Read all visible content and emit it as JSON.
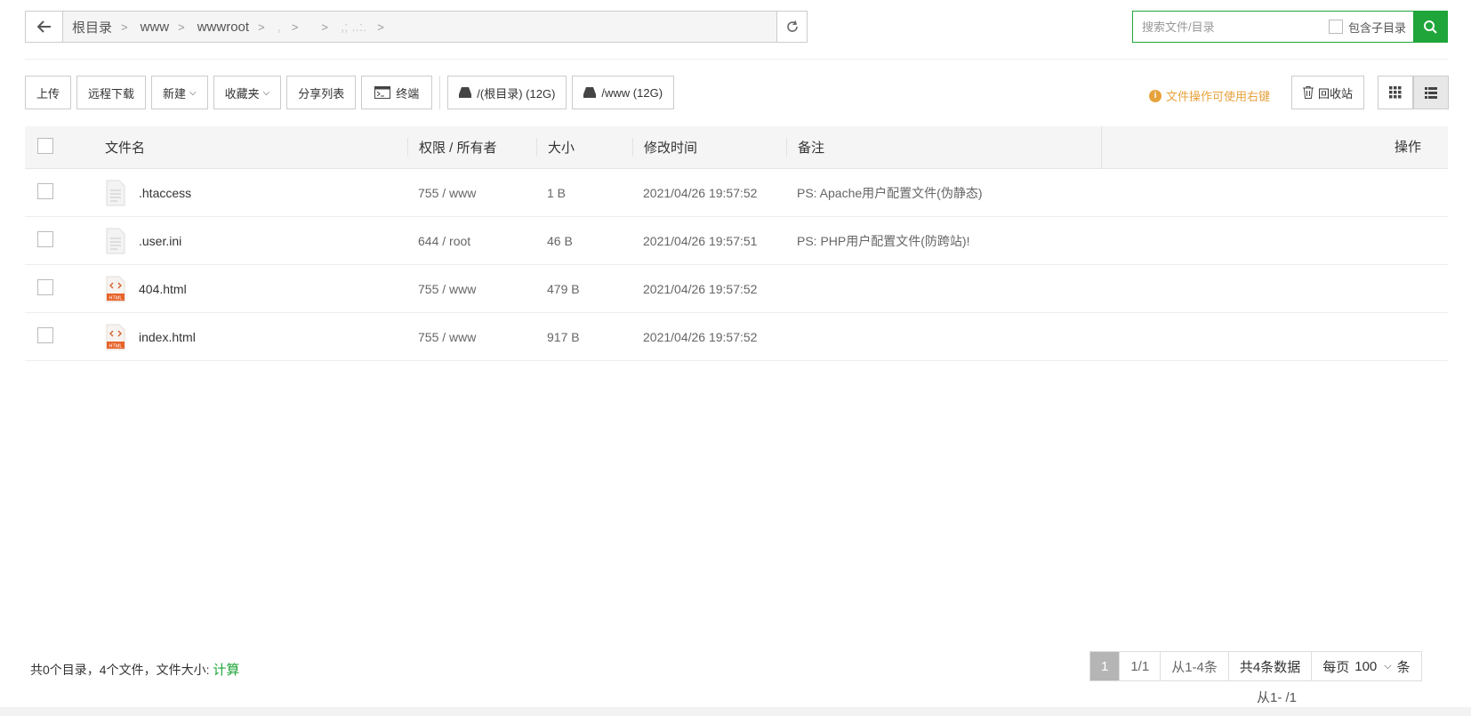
{
  "path": {
    "crumbs": [
      "根目录",
      "www",
      "wwwroot"
    ],
    "blurred": [
      ",",
      "",
      ",;  ..:."
    ]
  },
  "search": {
    "placeholder": "搜索文件/目录",
    "include_sub_label": "包含子目录"
  },
  "toolbar": {
    "upload": "上传",
    "remote_download": "远程下载",
    "new": "新建",
    "favorites": "收藏夹",
    "share_list": "分享列表",
    "terminal": "终端",
    "disk_root": "/(根目录) (12G)",
    "disk_www": "/www (12G)",
    "tip": "文件操作可使用右键",
    "recycle": "回收站"
  },
  "table": {
    "headers": {
      "name": "文件名",
      "perm": "权限 / 所有者",
      "size": "大小",
      "time": "修改时间",
      "note": "备注",
      "op": "操作"
    },
    "rows": [
      {
        "name": ".htaccess",
        "perm": "755 / www",
        "size": "1 B",
        "time": "2021/04/26 19:57:52",
        "note": "PS: Apache用户配置文件(伪静态)",
        "icon": "text-file-icon"
      },
      {
        "name": ".user.ini",
        "perm": "644 / root",
        "size": "46 B",
        "time": "2021/04/26 19:57:51",
        "note": "PS: PHP用户配置文件(防跨站)!",
        "icon": "text-file-icon"
      },
      {
        "name": "404.html",
        "perm": "755 / www",
        "size": "479 B",
        "time": "2021/04/26 19:57:52",
        "note": "",
        "icon": "html-file-icon"
      },
      {
        "name": "index.html",
        "perm": "755 / www",
        "size": "917 B",
        "time": "2021/04/26 19:57:52",
        "note": "",
        "icon": "html-file-icon"
      }
    ]
  },
  "footer": {
    "summary": "共0个目录，4个文件，文件大小: ",
    "calc": "计算",
    "page_current": "1",
    "page_total": "1/1",
    "range": "从1-4条",
    "total": "共4条数据",
    "per_page_label": "每页",
    "per_page_value": "100",
    "per_page_unit": "条",
    "range2": "从1- /1"
  },
  "colors": {
    "accent": "#20a53a",
    "tip": "#e6a23c"
  }
}
